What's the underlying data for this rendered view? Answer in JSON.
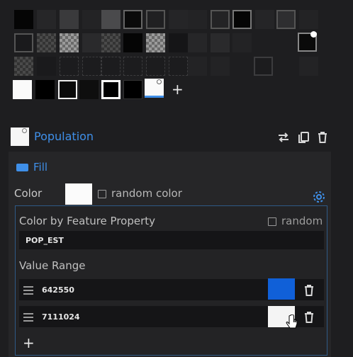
{
  "palette": {
    "add_symbol": "+"
  },
  "layer": {
    "name": "Population",
    "fill_label": "Fill",
    "color_label": "Color",
    "random_color_label": "random color",
    "by_feature_label": "Color by Feature Property",
    "random_label": "random",
    "property_value": "POP_EST",
    "value_range_label": "Value Range",
    "stops": [
      {
        "value": "642550",
        "color": "#1060d8"
      },
      {
        "value": "7111024",
        "color": "#f4f4f4"
      }
    ],
    "add_stop_symbol": "+"
  },
  "colors": {
    "accent": "#3f8fe8",
    "panel_border": "#2f5a86"
  }
}
